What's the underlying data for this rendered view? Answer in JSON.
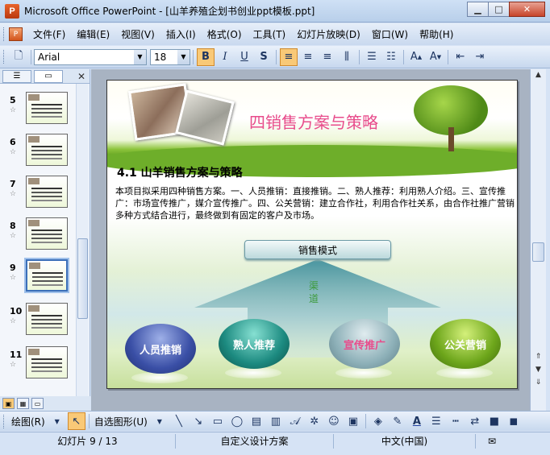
{
  "window": {
    "title": "Microsoft Office PowerPoint - [山羊养殖企划书创业ppt模板.ppt]",
    "minimize": "0",
    "maximize": "1",
    "close": "r"
  },
  "menubar": {
    "items": [
      "文件(F)",
      "编辑(E)",
      "视图(V)",
      "插入(I)",
      "格式(O)",
      "工具(T)",
      "幻灯片放映(D)",
      "窗口(W)",
      "帮助(H)"
    ]
  },
  "toolbar": {
    "font": "Arial",
    "size": "18",
    "bold": "B",
    "italic": "I",
    "underline": "U",
    "shadow": "S"
  },
  "thumbnails": [
    {
      "num": "5"
    },
    {
      "num": "6"
    },
    {
      "num": "7"
    },
    {
      "num": "8"
    },
    {
      "num": "9"
    },
    {
      "num": "10"
    },
    {
      "num": "11"
    }
  ],
  "slide": {
    "title": "四销售方案与策略",
    "section": "4.1 山羊销售方案与策略",
    "body": "本项目拟采用四种销售方案。一、人员推销：直接推销。二、熟人推荐：利用熟人介绍。三、宣传推广：市场宣传推广，媒介宣传推广。四、公关营销：建立合作社，利用合作社关系，由合作社推广营销多种方式结合进行，最终做到有固定的客户及市场。",
    "mode": "销售模式",
    "channel": "渠道",
    "balls": [
      "人员推销",
      "熟人推荐",
      "宣传推广",
      "公关营销"
    ]
  },
  "drawbar": {
    "draw": "绘图(R)",
    "autoshape": "自选图形(U)"
  },
  "status": {
    "slide": "幻灯片  9 / 13",
    "design": "自定义设计方案",
    "lang": "中文(中国)"
  },
  "colors": {
    "title_pink": "#e84c8b",
    "channel_green": "#3e9b3e"
  }
}
